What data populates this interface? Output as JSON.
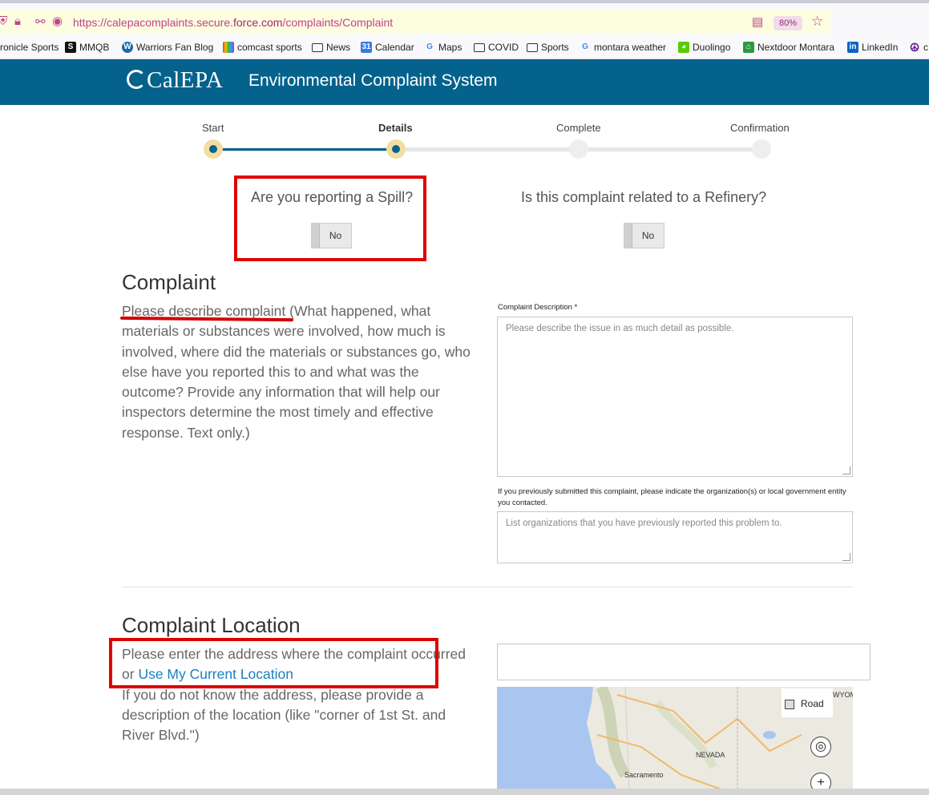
{
  "browser": {
    "url_prefix": "https://calepacomplaints.secure.",
    "url_host": "force.com",
    "url_suffix": "/complaints/Complaint",
    "zoom": "80%",
    "bookmarks": [
      {
        "label": "ronicle Sports",
        "icon": "sports-icon"
      },
      {
        "label": "MMQB",
        "icon": "si-icon"
      },
      {
        "label": "Warriors Fan Blog",
        "icon": "wordpress-icon"
      },
      {
        "label": "comcast sports",
        "icon": "nbc-peacock-icon"
      },
      {
        "label": "News",
        "icon": "folder-icon"
      },
      {
        "label": "Calendar",
        "icon": "calendar-icon"
      },
      {
        "label": "Maps",
        "icon": "google-icon"
      },
      {
        "label": "COVID",
        "icon": "folder-icon"
      },
      {
        "label": "Sports",
        "icon": "folder-icon"
      },
      {
        "label": "montara weather",
        "icon": "google-icon"
      },
      {
        "label": "Duolingo",
        "icon": "duolingo-icon"
      },
      {
        "label": "Nextdoor Montara",
        "icon": "nextdoor-icon"
      },
      {
        "label": "LinkedIn",
        "icon": "linkedin-icon"
      },
      {
        "label": "c",
        "icon": "peace-icon"
      }
    ]
  },
  "header": {
    "logo": "CalEPA",
    "title": "Environmental Complaint System",
    "bg_color": "#04628c"
  },
  "progress": {
    "steps": [
      "Start",
      "Details",
      "Complete",
      "Confirmation"
    ],
    "active_step": "Details"
  },
  "questions": {
    "spill": {
      "text": "Are you reporting a Spill?",
      "value": "No"
    },
    "refinery": {
      "text": "Is this complaint related to a Refinery?",
      "value": "No"
    }
  },
  "complaint": {
    "title": "Complaint",
    "lead": "Please describe complaint",
    "body": " (What happened, what materials or substances were involved, how much is involved, where did the materials or substances go, who else have you reported this to and what was the outcome? Provide any information that will help our inspectors determine the most timely and effective response. Text only.)",
    "description_label": "Complaint Description *",
    "description_placeholder": "Please describe the issue in as much detail as possible.",
    "prior_label": "If you previously submitted this complaint, please indicate the organization(s) or local government entity you contacted.",
    "prior_placeholder": "List organizations that you have previously reported this problem to."
  },
  "location": {
    "title": "Complaint Location",
    "line1": "Please enter the address where the complaint occurred or ",
    "link": "Use My Current Location",
    "line2": "If you do not know the address, please provide a description of the location (like \"corner of 1st St. and River Blvd.\")",
    "map": {
      "road_button": "Road",
      "labels": {
        "nevada": "NEVADA",
        "sacramento": "Sacramento",
        "wyoming": "WYOM"
      }
    }
  }
}
